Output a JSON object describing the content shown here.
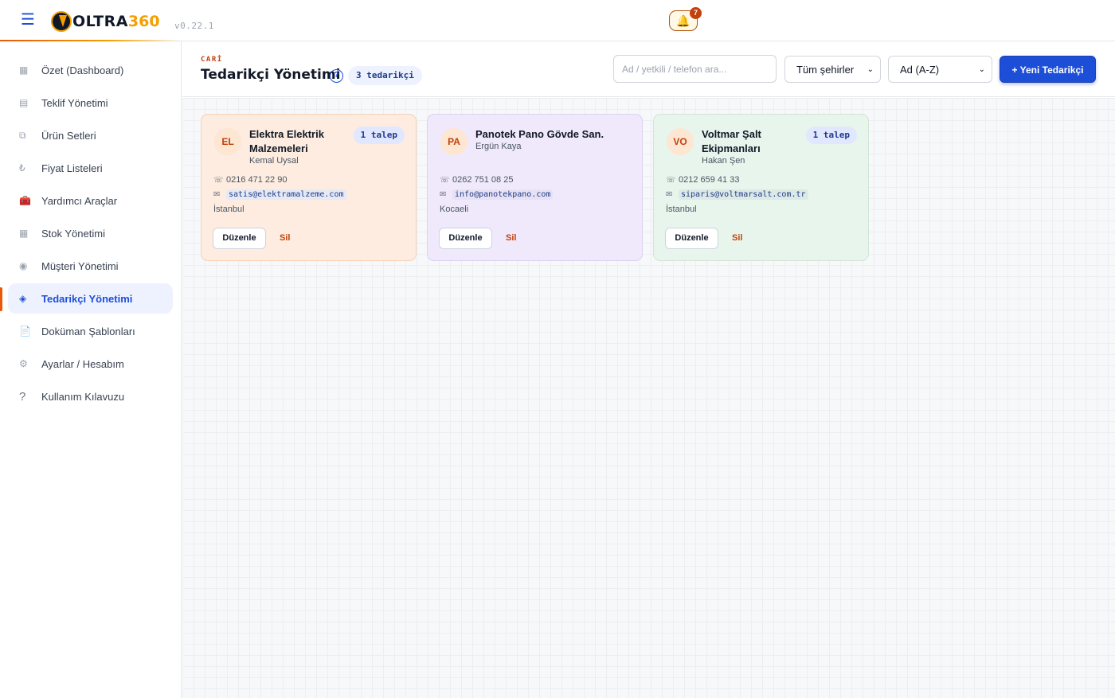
{
  "header": {
    "menu_icon": "☰",
    "logo_text": "OLTRA",
    "logo_number": "360",
    "version": "v0.22.1",
    "bell_icon": "🔔",
    "notification_count": "7"
  },
  "sidebar": {
    "items": [
      {
        "label": "Özet (Dashboard)",
        "icon": "▦"
      },
      {
        "label": "Teklif Yönetimi",
        "icon": "▤"
      },
      {
        "label": "Ürün Setleri",
        "icon": "⧉"
      },
      {
        "label": "Fiyat Listeleri",
        "icon": "₺"
      },
      {
        "label": "Yardımcı Araçlar",
        "icon": "🧰"
      },
      {
        "label": "Stok Yönetimi",
        "icon": "▦"
      },
      {
        "label": "Müşteri Yönetimi",
        "icon": "◉"
      },
      {
        "label": "Tedarikçi Yönetimi",
        "icon": "◈"
      },
      {
        "label": "Doküman Şablonları",
        "icon": "📄"
      },
      {
        "label": "Ayarlar / Hesabım",
        "icon": "⚙"
      },
      {
        "label": "Kullanım Kılavuzu",
        "icon": "?"
      }
    ],
    "active_index": 7
  },
  "page": {
    "eyebrow": "CARİ",
    "title": "Tedarikçi Yönetimi",
    "help_icon": "?",
    "count_label": "3 tedarikçi",
    "search_placeholder": "Ad / yetkili / telefon ara...",
    "city_filter": "Tüm şehirler",
    "sort_filter": "Ad (A-Z)",
    "new_button": "+ Yeni Tedarikçi"
  },
  "suppliers": [
    {
      "initials": "EL",
      "name_line1": "Elektra Elektrik",
      "name_line2": "Malzemeleri",
      "contact": "Kemal Uysal",
      "talep": "1 talep",
      "phone": "0216 471 22 90",
      "email": "satis@elektramalzeme.com",
      "city": "İstanbul",
      "edit_label": "Düzenle",
      "delete_label": "Sil"
    },
    {
      "initials": "PA",
      "name_line1": "Panotek Pano Gövde San.",
      "name_line2": "",
      "contact": "Ergün Kaya",
      "talep": "",
      "phone": "0262 751 08 25",
      "email": "info@panotekpano.com",
      "city": "Kocaeli",
      "edit_label": "Düzenle",
      "delete_label": "Sil"
    },
    {
      "initials": "VO",
      "name_line1": "Voltmar Şalt",
      "name_line2": "Ekipmanları",
      "contact": "Hakan Şen",
      "talep": "1 talep",
      "phone": "0212 659 41 33",
      "email": "siparis@voltmarsalt.com.tr",
      "city": "İstanbul",
      "edit_label": "Düzenle",
      "delete_label": "Sil"
    }
  ],
  "icons": {
    "phone": "☏",
    "mail": "✉",
    "chevron": "⌄"
  },
  "colors": {
    "brand_blue": "#1d4ed8",
    "accent_orange": "#e8590c",
    "logo_gold": "#f59f00",
    "delete_red": "#c2410c"
  }
}
